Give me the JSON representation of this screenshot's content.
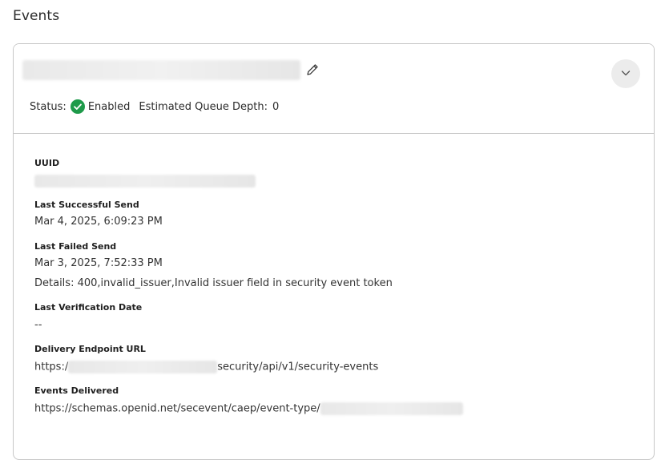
{
  "page": {
    "title": "Events"
  },
  "card": {
    "status_label": "Status:",
    "status_value": "Enabled",
    "queue_label": "Estimated Queue Depth:",
    "queue_value": "0",
    "status_color": "#1e9a4a"
  },
  "details": {
    "uuid_label": "UUID",
    "last_success_label": "Last Successful Send",
    "last_success_value": "Mar 4, 2025, 6:09:23 PM",
    "last_failed_label": "Last Failed Send",
    "last_failed_value": "Mar 3, 2025, 7:52:33 PM",
    "last_failed_details": "Details: 400,invalid_issuer,Invalid issuer field in security event token",
    "last_verification_label": "Last Verification Date",
    "last_verification_value": "--",
    "endpoint_label": "Delivery Endpoint URL",
    "endpoint_prefix": "https:/",
    "endpoint_suffix": "security/api/v1/security-events",
    "events_label": "Events Delivered",
    "events_prefix": "https://schemas.openid.net/secevent/caep/event-type/"
  }
}
